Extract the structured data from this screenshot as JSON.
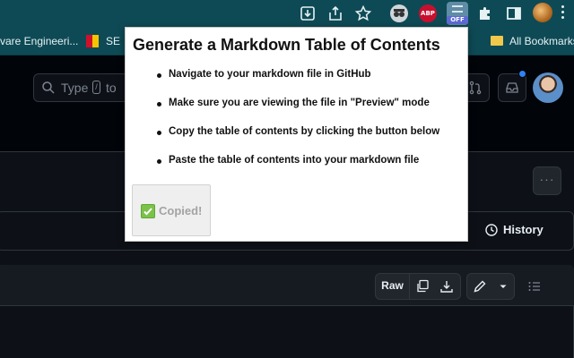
{
  "browser": {
    "extensions": [
      "download-icon",
      "share-icon",
      "star-icon",
      "spy-extension-icon",
      "adblock-plus-icon",
      "markdown-toc-extension-icon",
      "puzzle-icon",
      "sidebar-icon"
    ],
    "abp_label": "ABP",
    "toc_badge": "OFF"
  },
  "bookmarks": {
    "items": [
      {
        "label": "vare Engineeri..."
      },
      {
        "label": "SE"
      },
      {
        "label": "All Bookmarks"
      }
    ]
  },
  "github": {
    "search_placeholder_a": "Type",
    "search_kbd": "/",
    "search_placeholder_b": "to",
    "history_label": "History",
    "raw_label": "Raw"
  },
  "popup": {
    "title": "Generate a Markdown Table of Contents",
    "steps": [
      "Navigate to your markdown file in GitHub",
      "Make sure you are viewing the file in \"Preview\" mode",
      "Copy the table of contents by clicking the button below",
      "Paste the table of contents into your markdown file"
    ],
    "button_label": "Copied!"
  },
  "colors": {
    "chrome_toolbar": "#0e4a55",
    "github_bg": "#0d1117",
    "accent_blue": "#2f81f7",
    "check_green": "#7cc24a"
  }
}
